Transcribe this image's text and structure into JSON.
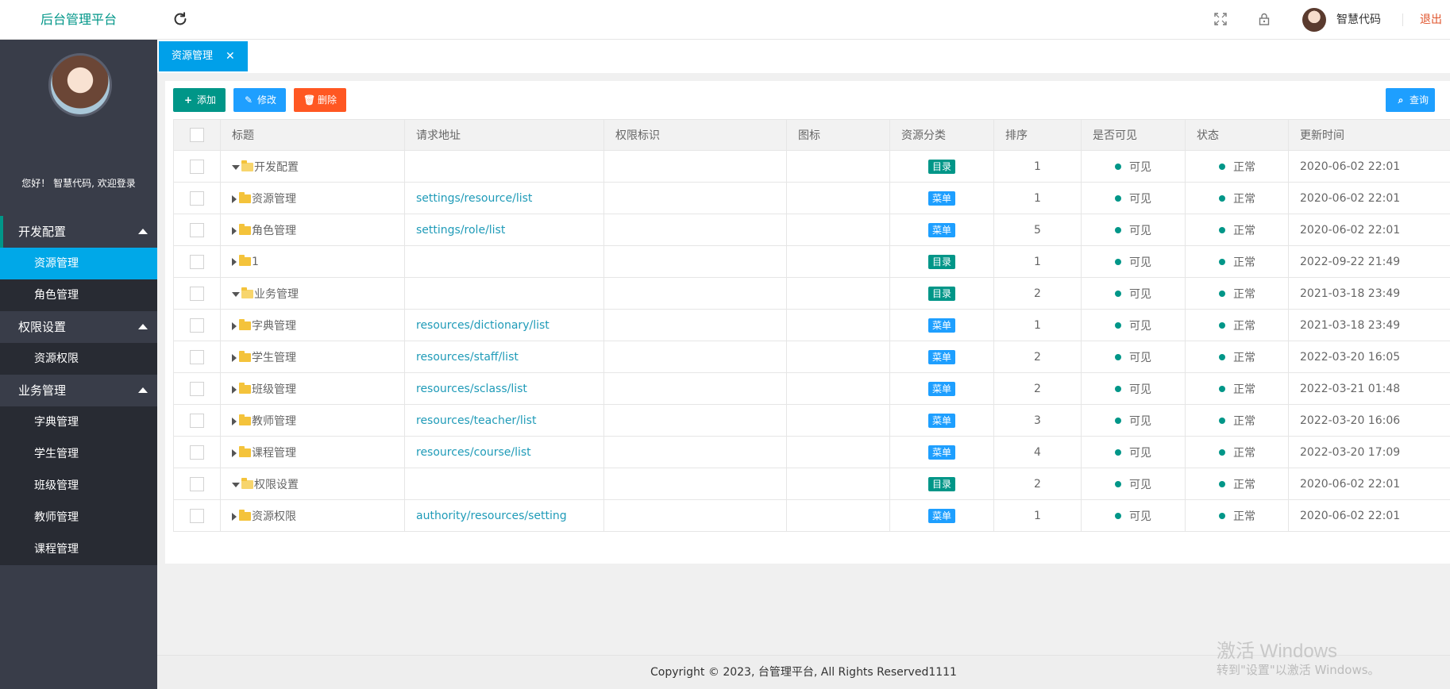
{
  "header": {
    "logo": "后台管理平台",
    "user_name": "智慧代码",
    "logout": "退出",
    "icons": {
      "refresh": "refresh-icon",
      "fullscreen": "fullscreen-icon",
      "lock": "lock-icon"
    }
  },
  "sidebar": {
    "welcome": "您好！ 智慧代码, 欢迎登录",
    "groups": [
      {
        "label": "开发配置",
        "items": [
          "资源管理",
          "角色管理"
        ]
      },
      {
        "label": "权限设置",
        "items": [
          "资源权限"
        ]
      },
      {
        "label": "业务管理",
        "items": [
          "字典管理",
          "学生管理",
          "班级管理",
          "教师管理",
          "课程管理"
        ]
      }
    ],
    "active_item": "资源管理"
  },
  "tabs": [
    {
      "label": "资源管理",
      "close": "✕"
    }
  ],
  "toolbar": {
    "add": "添加",
    "edit": "修改",
    "delete": "删除",
    "search": "查询"
  },
  "table": {
    "columns": [
      "标题",
      "请求地址",
      "权限标识",
      "图标",
      "资源分类",
      "排序",
      "是否可见",
      "状态",
      "更新时间"
    ],
    "rows": [
      {
        "title": "开发配置",
        "url": "",
        "perm": "",
        "icon": "",
        "type": "目录",
        "sort": "1",
        "visible": "可见",
        "status": "正常",
        "updated": "2020-06-02 22:01"
      },
      {
        "title": "资源管理",
        "url": "settings/resource/list",
        "perm": "",
        "icon": "",
        "type": "菜单",
        "sort": "1",
        "visible": "可见",
        "status": "正常",
        "updated": "2020-06-02 22:01"
      },
      {
        "title": "角色管理",
        "url": "settings/role/list",
        "perm": "",
        "icon": "",
        "type": "菜单",
        "sort": "5",
        "visible": "可见",
        "status": "正常",
        "updated": "2020-06-02 22:01"
      },
      {
        "title": "1",
        "url": "",
        "perm": "",
        "icon": "",
        "type": "目录",
        "sort": "1",
        "visible": "可见",
        "status": "正常",
        "updated": "2022-09-22 21:49"
      },
      {
        "title": "业务管理",
        "url": "",
        "perm": "",
        "icon": "",
        "type": "目录",
        "sort": "2",
        "visible": "可见",
        "status": "正常",
        "updated": "2021-03-18 23:49"
      },
      {
        "title": "字典管理",
        "url": "resources/dictionary/list",
        "perm": "",
        "icon": "",
        "type": "菜单",
        "sort": "1",
        "visible": "可见",
        "status": "正常",
        "updated": "2021-03-18 23:49"
      },
      {
        "title": "学生管理",
        "url": "resources/staff/list",
        "perm": "",
        "icon": "",
        "type": "菜单",
        "sort": "2",
        "visible": "可见",
        "status": "正常",
        "updated": "2022-03-20 16:05"
      },
      {
        "title": "班级管理",
        "url": "resources/sclass/list",
        "perm": "",
        "icon": "",
        "type": "菜单",
        "sort": "2",
        "visible": "可见",
        "status": "正常",
        "updated": "2022-03-21 01:48"
      },
      {
        "title": "教师管理",
        "url": "resources/teacher/list",
        "perm": "",
        "icon": "",
        "type": "菜单",
        "sort": "3",
        "visible": "可见",
        "status": "正常",
        "updated": "2022-03-20 16:06"
      },
      {
        "title": "课程管理",
        "url": "resources/course/list",
        "perm": "",
        "icon": "",
        "type": "菜单",
        "sort": "4",
        "visible": "可见",
        "status": "正常",
        "updated": "2022-03-20 17:09"
      },
      {
        "title": "权限设置",
        "url": "",
        "perm": "",
        "icon": "",
        "type": "目录",
        "sort": "2",
        "visible": "可见",
        "status": "正常",
        "updated": "2020-06-02 22:01"
      },
      {
        "title": "资源权限",
        "url": "authority/resources/setting",
        "perm": "",
        "icon": "",
        "type": "菜单",
        "sort": "1",
        "visible": "可见",
        "status": "正常",
        "updated": "2020-06-02 22:01"
      }
    ]
  },
  "footer": "Copyright © 2023, 台管理平台, All Rights Reserved1111",
  "watermark": {
    "line1": "激活 Windows",
    "line2": "转到\"设置\"以激活 Windows。"
  },
  "colors": {
    "primary": "#009688",
    "accent": "#1e9fff",
    "danger": "#ff5722",
    "sidebar": "#393d49",
    "active_menu": "#00a8e8"
  }
}
